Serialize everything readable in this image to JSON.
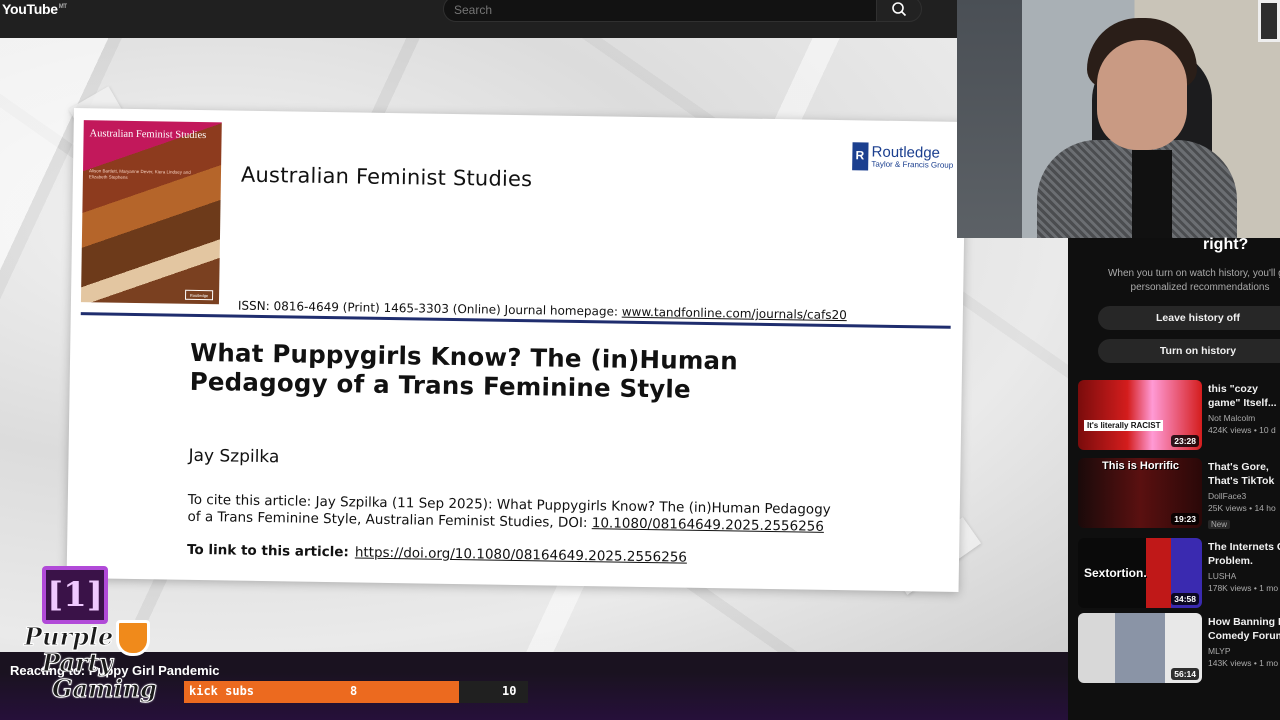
{
  "youtube": {
    "logo": "YouTube",
    "logo_sup": "MT",
    "search_placeholder": "Search"
  },
  "article": {
    "cover_title": "Australian Feminist Studies",
    "cover_authors": "Alison Bartlett, Maryanne Dever, Kiera Lindsey and Elizabeth Stephens",
    "journal": "Australian Feminist Studies",
    "publisher": "Routledge",
    "publisher_sub": "Taylor & Francis Group",
    "issn_text": "ISSN: 0816-4649 (Print) 1465-3303 (Online) Journal homepage:",
    "homepage_url": "www.tandfonline.com/journals/cafs20",
    "title": "What Puppygirls Know? The (in)Human Pedagogy of a Trans Feminine Style",
    "author": "Jay Szpilka",
    "cite_label": "To cite this article:",
    "cite_text": "Jay Szpilka (11 Sep 2025): What Puppygirls Know? The (in)Human Pedagogy of a Trans Feminine Style, Australian Feminist Studies, DOI:",
    "doi": "10.1080/08164649.2025.2556256",
    "link_label": "To link to this article:",
    "link_url": "https://doi.org/10.1080/08164649.2025.2556256"
  },
  "sidebar": {
    "heading": "right?",
    "message": "When you turn on watch history, you'll get personalized recommendations",
    "buttons": [
      "Leave history off",
      "Turn on history"
    ],
    "recommendations": [
      {
        "title": "this \"cozy game\" Itself...",
        "channel": "Not Malcolm",
        "meta": "424K views • 10 d",
        "duration": "23:28",
        "thumb_text": "It's literally RACIST",
        "badge": ""
      },
      {
        "title": "That's Gore, That's TikTok",
        "channel": "DollFace3",
        "meta": "25K views • 14 ho",
        "duration": "19:23",
        "thumb_text": "This is Horrific",
        "badge": "New"
      },
      {
        "title": "The Internets C Problem.",
        "channel": "LUSHA",
        "meta": "178K views • 1 mo",
        "duration": "34:58",
        "thumb_text": "Sextortion.",
        "badge": ""
      },
      {
        "title": "How Banning H Comedy Forum",
        "channel": "MLYP",
        "meta": "143K views • 1 mo",
        "duration": "56:14",
        "thumb_text": "",
        "badge": ""
      }
    ]
  },
  "overlay": {
    "now_playing": "Reacting to: Puppy Girl Pandemic",
    "brand_badge": "[1]",
    "brand_line1": "Purple",
    "brand_line2": "Party",
    "brand_line3": "Gaming",
    "goal_label": "kick subs",
    "goal_current": "8",
    "goal_target": "10",
    "goal_fraction": 0.8
  },
  "colors": {
    "accent_orange": "#ec6a1f",
    "journal_rule": "#1f2d6e",
    "routledge_blue": "#1b3f8f"
  }
}
